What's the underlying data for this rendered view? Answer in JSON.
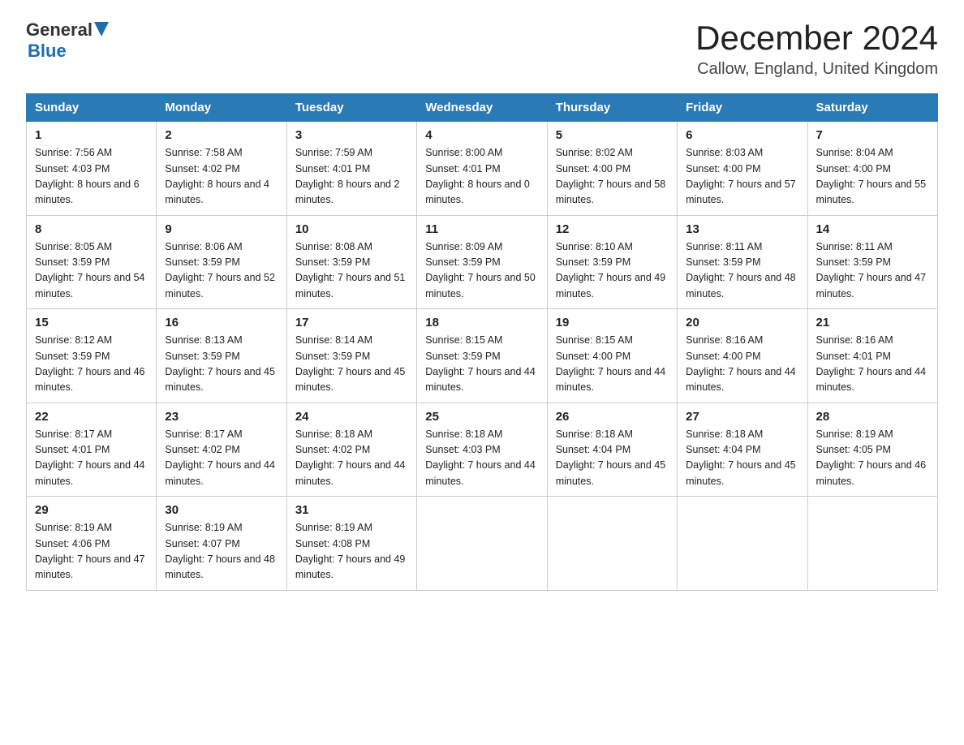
{
  "header": {
    "logo_general": "General",
    "logo_blue": "Blue",
    "title": "December 2024",
    "location": "Callow, England, United Kingdom"
  },
  "days_of_week": [
    "Sunday",
    "Monday",
    "Tuesday",
    "Wednesday",
    "Thursday",
    "Friday",
    "Saturday"
  ],
  "weeks": [
    [
      {
        "day": "1",
        "sunrise": "7:56 AM",
        "sunset": "4:03 PM",
        "daylight": "8 hours and 6 minutes."
      },
      {
        "day": "2",
        "sunrise": "7:58 AM",
        "sunset": "4:02 PM",
        "daylight": "8 hours and 4 minutes."
      },
      {
        "day": "3",
        "sunrise": "7:59 AM",
        "sunset": "4:01 PM",
        "daylight": "8 hours and 2 minutes."
      },
      {
        "day": "4",
        "sunrise": "8:00 AM",
        "sunset": "4:01 PM",
        "daylight": "8 hours and 0 minutes."
      },
      {
        "day": "5",
        "sunrise": "8:02 AM",
        "sunset": "4:00 PM",
        "daylight": "7 hours and 58 minutes."
      },
      {
        "day": "6",
        "sunrise": "8:03 AM",
        "sunset": "4:00 PM",
        "daylight": "7 hours and 57 minutes."
      },
      {
        "day": "7",
        "sunrise": "8:04 AM",
        "sunset": "4:00 PM",
        "daylight": "7 hours and 55 minutes."
      }
    ],
    [
      {
        "day": "8",
        "sunrise": "8:05 AM",
        "sunset": "3:59 PM",
        "daylight": "7 hours and 54 minutes."
      },
      {
        "day": "9",
        "sunrise": "8:06 AM",
        "sunset": "3:59 PM",
        "daylight": "7 hours and 52 minutes."
      },
      {
        "day": "10",
        "sunrise": "8:08 AM",
        "sunset": "3:59 PM",
        "daylight": "7 hours and 51 minutes."
      },
      {
        "day": "11",
        "sunrise": "8:09 AM",
        "sunset": "3:59 PM",
        "daylight": "7 hours and 50 minutes."
      },
      {
        "day": "12",
        "sunrise": "8:10 AM",
        "sunset": "3:59 PM",
        "daylight": "7 hours and 49 minutes."
      },
      {
        "day": "13",
        "sunrise": "8:11 AM",
        "sunset": "3:59 PM",
        "daylight": "7 hours and 48 minutes."
      },
      {
        "day": "14",
        "sunrise": "8:11 AM",
        "sunset": "3:59 PM",
        "daylight": "7 hours and 47 minutes."
      }
    ],
    [
      {
        "day": "15",
        "sunrise": "8:12 AM",
        "sunset": "3:59 PM",
        "daylight": "7 hours and 46 minutes."
      },
      {
        "day": "16",
        "sunrise": "8:13 AM",
        "sunset": "3:59 PM",
        "daylight": "7 hours and 45 minutes."
      },
      {
        "day": "17",
        "sunrise": "8:14 AM",
        "sunset": "3:59 PM",
        "daylight": "7 hours and 45 minutes."
      },
      {
        "day": "18",
        "sunrise": "8:15 AM",
        "sunset": "3:59 PM",
        "daylight": "7 hours and 44 minutes."
      },
      {
        "day": "19",
        "sunrise": "8:15 AM",
        "sunset": "4:00 PM",
        "daylight": "7 hours and 44 minutes."
      },
      {
        "day": "20",
        "sunrise": "8:16 AM",
        "sunset": "4:00 PM",
        "daylight": "7 hours and 44 minutes."
      },
      {
        "day": "21",
        "sunrise": "8:16 AM",
        "sunset": "4:01 PM",
        "daylight": "7 hours and 44 minutes."
      }
    ],
    [
      {
        "day": "22",
        "sunrise": "8:17 AM",
        "sunset": "4:01 PM",
        "daylight": "7 hours and 44 minutes."
      },
      {
        "day": "23",
        "sunrise": "8:17 AM",
        "sunset": "4:02 PM",
        "daylight": "7 hours and 44 minutes."
      },
      {
        "day": "24",
        "sunrise": "8:18 AM",
        "sunset": "4:02 PM",
        "daylight": "7 hours and 44 minutes."
      },
      {
        "day": "25",
        "sunrise": "8:18 AM",
        "sunset": "4:03 PM",
        "daylight": "7 hours and 44 minutes."
      },
      {
        "day": "26",
        "sunrise": "8:18 AM",
        "sunset": "4:04 PM",
        "daylight": "7 hours and 45 minutes."
      },
      {
        "day": "27",
        "sunrise": "8:18 AM",
        "sunset": "4:04 PM",
        "daylight": "7 hours and 45 minutes."
      },
      {
        "day": "28",
        "sunrise": "8:19 AM",
        "sunset": "4:05 PM",
        "daylight": "7 hours and 46 minutes."
      }
    ],
    [
      {
        "day": "29",
        "sunrise": "8:19 AM",
        "sunset": "4:06 PM",
        "daylight": "7 hours and 47 minutes."
      },
      {
        "day": "30",
        "sunrise": "8:19 AM",
        "sunset": "4:07 PM",
        "daylight": "7 hours and 48 minutes."
      },
      {
        "day": "31",
        "sunrise": "8:19 AM",
        "sunset": "4:08 PM",
        "daylight": "7 hours and 49 minutes."
      },
      null,
      null,
      null,
      null
    ]
  ]
}
